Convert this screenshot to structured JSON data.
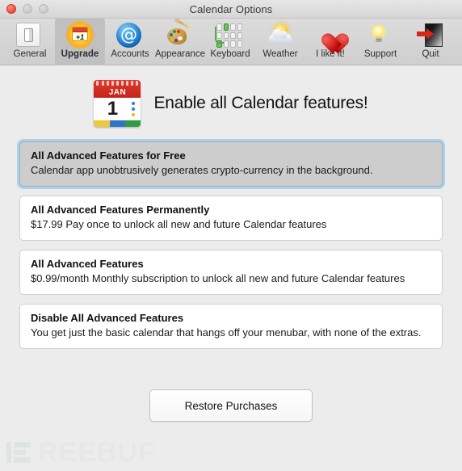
{
  "window": {
    "title": "Calendar Options",
    "traffic_lights": [
      "close",
      "minimize",
      "maximize"
    ]
  },
  "toolbar": {
    "left_items": [
      {
        "label": "General",
        "icon": "general-icon",
        "selected": false
      },
      {
        "label": "Upgrade",
        "icon": "upgrade-icon",
        "selected": true
      },
      {
        "label": "Accounts",
        "icon": "at-sign-icon",
        "selected": false
      },
      {
        "label": "Appearance",
        "icon": "palette-icon",
        "selected": false
      },
      {
        "label": "Keyboard",
        "icon": "keyboard-icon",
        "selected": false
      },
      {
        "label": "Weather",
        "icon": "sun-cloud-icon",
        "selected": false
      }
    ],
    "right_items": [
      {
        "label": "I like it!",
        "icon": "heart-icon",
        "selected": false
      },
      {
        "label": "Support",
        "icon": "lightbulb-icon",
        "selected": false
      },
      {
        "label": "Quit",
        "icon": "exit-door-icon",
        "selected": false
      }
    ]
  },
  "hero": {
    "icon": "calendar-icon",
    "calendar_month": "JAN",
    "calendar_day": "1",
    "title": "Enable all Calendar features!"
  },
  "options": [
    {
      "title": "All Advanced Features for Free",
      "description": "Calendar app unobtrusively generates crypto-currency in the background.",
      "selected": true
    },
    {
      "title": "All Advanced Features Permanently",
      "description": "$17.99 Pay once to unlock all new and future Calendar features",
      "selected": false
    },
    {
      "title": "All Advanced Features",
      "description": "$0.99/month Monthly subscription to unlock all new and future Calendar features",
      "selected": false
    },
    {
      "title": "Disable All Advanced Features",
      "description": "You get just the basic calendar that hangs off your menubar, with none of the extras.",
      "selected": false
    }
  ],
  "footer": {
    "restore_label": "Restore Purchases"
  },
  "watermark": {
    "text": "REEBUF"
  },
  "colors": {
    "window_bg": "#ececec",
    "toolbar_bg": "#d4d4d4",
    "selected_tab_bg": "#c0c0c0",
    "card_bg": "#ffffff",
    "selected_card_bg": "#cdcdcd",
    "focus_ring": "#a8d2f0",
    "close_button": "#ef4b3c",
    "calendar_red": "#c4231a"
  }
}
